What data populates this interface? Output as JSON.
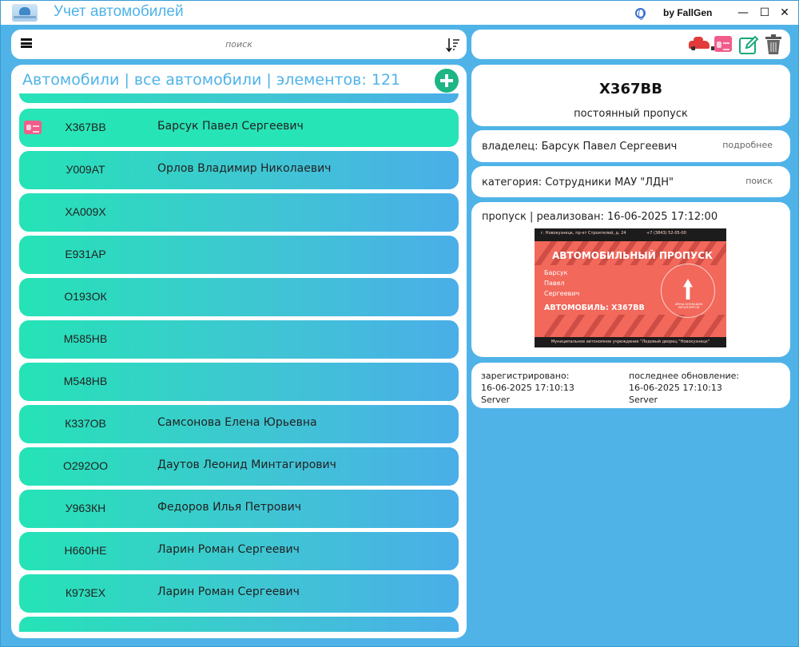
{
  "window": {
    "title": "Учет автомобилей",
    "byline": "by FallGen",
    "minimize_glyph": "—",
    "maximize_glyph": "☐",
    "close_glyph": "✕"
  },
  "toolbar_left": {
    "search_placeholder": "поиск"
  },
  "list": {
    "title": "Автомобили | все автомобили | элементов: 121",
    "rows": [
      {
        "plate": "Х367ВВ",
        "owner": "Барсук Павел Сергеевич",
        "selected": true,
        "has_pass": true
      },
      {
        "plate": "У009АТ",
        "owner": "Орлов Владимир Николаевич"
      },
      {
        "plate": "ХА009Х",
        "owner": ""
      },
      {
        "plate": "Е931АР",
        "owner": ""
      },
      {
        "plate": "О193ОК",
        "owner": ""
      },
      {
        "plate": "М585НВ",
        "owner": ""
      },
      {
        "plate": "М548НВ",
        "owner": ""
      },
      {
        "plate": "К337ОВ",
        "owner": "Самсонова Елена Юрьевна"
      },
      {
        "plate": "О292ОО",
        "owner": "Даутов Леонид Минтагирович"
      },
      {
        "plate": "У963КН",
        "owner": "Федоров Илья Петрович"
      },
      {
        "plate": "Н660НЕ",
        "owner": "Ларин Роман Сергеевич"
      },
      {
        "plate": "К973ЕХ",
        "owner": "Ларин Роман Сергеевич"
      }
    ]
  },
  "details": {
    "plate": "Х367ВВ",
    "pass_type": "постоянный пропуск",
    "owner_text": "владелец: Барсук Павел Сергеевич",
    "owner_link": "подробнее",
    "category_text": "категория: Сотрудники МАУ \"ЛДН\"",
    "category_link": "поиск",
    "pass_text": "пропуск | реализован: 16-06-2025 17:12:00",
    "pass_image": {
      "address": "г. Новокузнецк, пр-кт Строителей, д. 24",
      "phone": "+7 (3843) 52-05-00",
      "heading": "АВТОМОБИЛЬНЫЙ ПРОПУСК",
      "name_lines": [
        "Барсук",
        "Павел",
        "Сергеевич"
      ],
      "car_line": "АВТОМОБИЛЬ: Х367ВВ",
      "footer": "Муниципальное автономное учреждение \"Ледовый дворец \"Новокузнецк\"",
      "logo_text": "АРЕНА КУЗНЕЦКИХ МЕТАЛЛУРГОВ"
    },
    "registered_label": "зарегистрировано:",
    "registered_date": "16-06-2025 17:10:13",
    "registered_by": "Server",
    "updated_label": "последнее обновление:",
    "updated_date": "16-06-2025 17:10:13",
    "updated_by": "Server"
  },
  "colors": {
    "background": "#4fb3e8",
    "accent": "#4fb3e8",
    "row_gradient_start": "#25e3b6",
    "row_gradient_end": "#4aaee8",
    "add_button": "#1db584",
    "pass_card": "#f2685b"
  },
  "icons": [
    "menu-icon",
    "sort-icon",
    "add-icon",
    "pass-badge-icon",
    "car-icon",
    "pass-icon",
    "edit-icon",
    "trash-icon",
    "globe-icon"
  ]
}
